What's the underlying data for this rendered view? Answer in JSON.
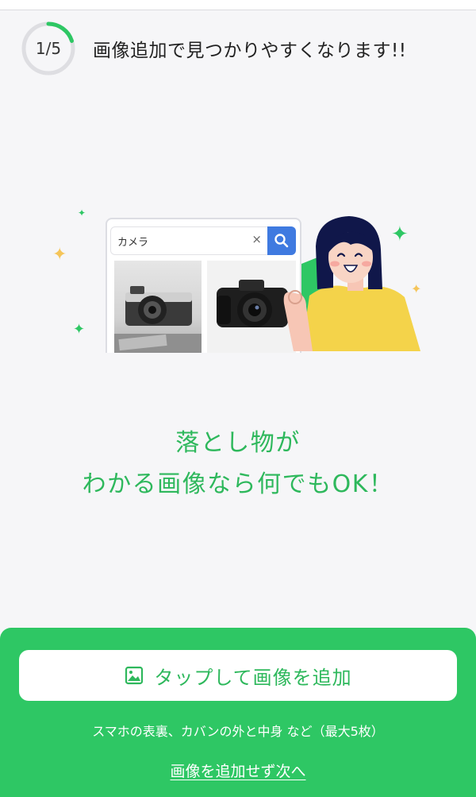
{
  "header": {
    "progress_label": "1/5",
    "progress_fraction": 0.2,
    "title": "画像追加で見つかりやすくなります!!"
  },
  "illustration": {
    "search_query": "カメラ",
    "clear_icon": "close-icon",
    "search_icon": "search-icon",
    "items": [
      "camera-photo-1",
      "camera-photo-2",
      "smiling-person-ok-gesture"
    ]
  },
  "headline": {
    "line1": "落とし物が",
    "line2": "わかる画像なら何でもOK！"
  },
  "actions": {
    "add_image_label": "タップして画像を追加",
    "add_image_icon": "image-icon",
    "note": "スマホの表裏、カバンの外と中身 など（最大5枚）",
    "skip_label": "画像を追加せず次へ"
  },
  "colors": {
    "accent_green": "#2ec764",
    "text_green": "#2eb85c",
    "search_blue": "#3f7ae0",
    "background": "#f6f6f8"
  }
}
